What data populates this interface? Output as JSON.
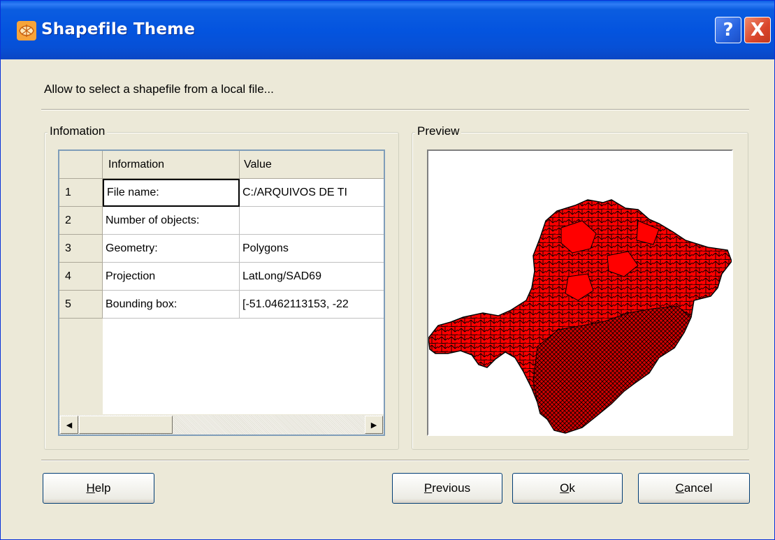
{
  "window": {
    "title": "Shapefile Theme",
    "help_glyph": "?",
    "close_glyph": "X"
  },
  "description": "Allow to select a shapefile from a local file...",
  "info_group": {
    "legend": "Infomation",
    "columns": [
      "Information",
      "Value"
    ],
    "rows": [
      {
        "num": "1",
        "info": "File name:",
        "value": "C:/ARQUIVOS DE TI"
      },
      {
        "num": "2",
        "info": "Number of objects:",
        "value": ""
      },
      {
        "num": "3",
        "info": "Geometry:",
        "value": "Polygons"
      },
      {
        "num": "4",
        "info": "Projection",
        "value": "LatLong/SAD69"
      },
      {
        "num": "5",
        "info": "Bounding box:",
        "value": "[-51.0462113153, -22"
      }
    ],
    "scroll_left_icon": "◀",
    "scroll_right_icon": "▶"
  },
  "preview_group": {
    "legend": "Preview",
    "map_fill": "#ff0000",
    "map_stroke": "#000000"
  },
  "buttons": {
    "help": {
      "mnemonic": "H",
      "rest": "elp"
    },
    "previous": {
      "mnemonic": "P",
      "rest": "revious"
    },
    "ok": {
      "mnemonic": "O",
      "rest": "k"
    },
    "cancel": {
      "mnemonic": "C",
      "rest": "ancel"
    }
  },
  "colors": {
    "titlebar": "#0454df",
    "dialog_bg": "#ece9d8"
  }
}
